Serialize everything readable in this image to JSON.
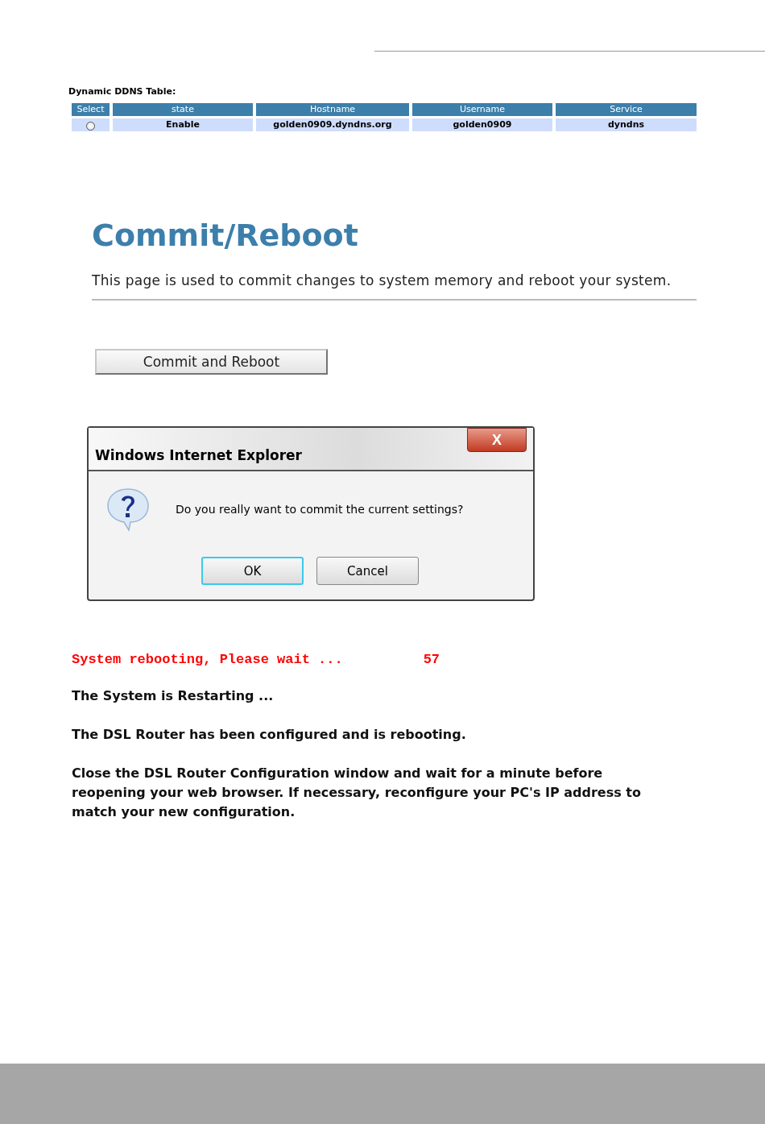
{
  "ddns_table": {
    "title": "Dynamic DDNS Table:",
    "columns": [
      "Select",
      "state",
      "Hostname",
      "Username",
      "Service"
    ],
    "rows": [
      {
        "selected": false,
        "state": "Enable",
        "hostname": "golden0909.dyndns.org",
        "username": "golden0909",
        "service": "dyndns"
      }
    ]
  },
  "commit_page": {
    "heading": "Commit/Reboot",
    "description": "This page is used to commit changes to system memory and reboot your system.",
    "button": "Commit and Reboot"
  },
  "dialog": {
    "title": "Windows Internet Explorer",
    "close": "X",
    "message": "Do you really want to commit the current settings?",
    "buttons": [
      {
        "label": "OK",
        "default": true
      },
      {
        "label": "Cancel",
        "default": false
      }
    ]
  },
  "reboot": {
    "status": "System rebooting, Please wait ...",
    "countdown": "57",
    "paragraphs": [
      "The System is Restarting ...",
      "The DSL Router has been configured and is rebooting.",
      "Close the DSL Router Configuration window and wait for a minute before reopening your web browser. If necessary, reconfigure your PC's IP address to match your new configuration."
    ]
  }
}
